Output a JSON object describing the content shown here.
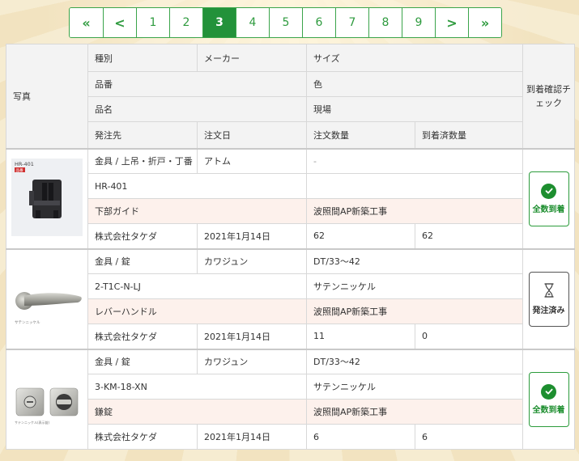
{
  "pagination": {
    "first": "«",
    "prev": "<",
    "pages": [
      "1",
      "2",
      "3",
      "4",
      "5",
      "6",
      "7",
      "8",
      "9"
    ],
    "current": "3",
    "next": ">",
    "last": "»"
  },
  "table": {
    "headers": {
      "photo": "写真",
      "type": "種別",
      "maker": "メーカー",
      "size": "サイズ",
      "part_no": "品番",
      "color": "色",
      "name": "品名",
      "site": "現場",
      "supplier": "発注先",
      "order_date": "注文日",
      "order_qty": "注文数量",
      "arrived_qty": "到着済数量",
      "check": "到着確認チェック"
    },
    "rows": [
      {
        "photo_label": "HR-401",
        "photo_badge": "品番",
        "type": "金具 / 上吊・折戸・丁番",
        "maker": "アトム",
        "size": "-",
        "part_no": "HR-401",
        "color": "",
        "name": "下部ガイド",
        "site": "波照間AP新築工事",
        "supplier": "株式会社タケダ",
        "order_date": "2021年1月14日",
        "order_qty": "62",
        "arrived_qty": "62",
        "status": "全数到着",
        "status_kind": "done"
      },
      {
        "photo_label": "サテンニッケル",
        "type": "金具 / 錠",
        "maker": "カワジュン",
        "size": "DT/33〜42",
        "part_no": "2-T1C-N-LJ",
        "color": "サテンニッケル",
        "name": "レバーハンドル",
        "site": "波照間AP新築工事",
        "supplier": "株式会社タケダ",
        "order_date": "2021年1月14日",
        "order_qty": "11",
        "arrived_qty": "0",
        "status": "発注済み",
        "status_kind": "ordered"
      },
      {
        "photo_label": "サテンニッケル(表示錠)",
        "type": "金具 / 錠",
        "maker": "カワジュン",
        "size": "DT/33〜42",
        "part_no": "3-KM-18-XN",
        "color": "サテンニッケル",
        "name": "鎌錠",
        "site": "波照間AP新築工事",
        "supplier": "株式会社タケダ",
        "order_date": "2021年1月14日",
        "order_qty": "6",
        "arrived_qty": "6",
        "status": "全数到着",
        "status_kind": "done"
      }
    ]
  },
  "colors": {
    "accent_green": "#23923a",
    "name_row_bg": "#fdf1ec",
    "page_bg": "#f6ecd0"
  }
}
